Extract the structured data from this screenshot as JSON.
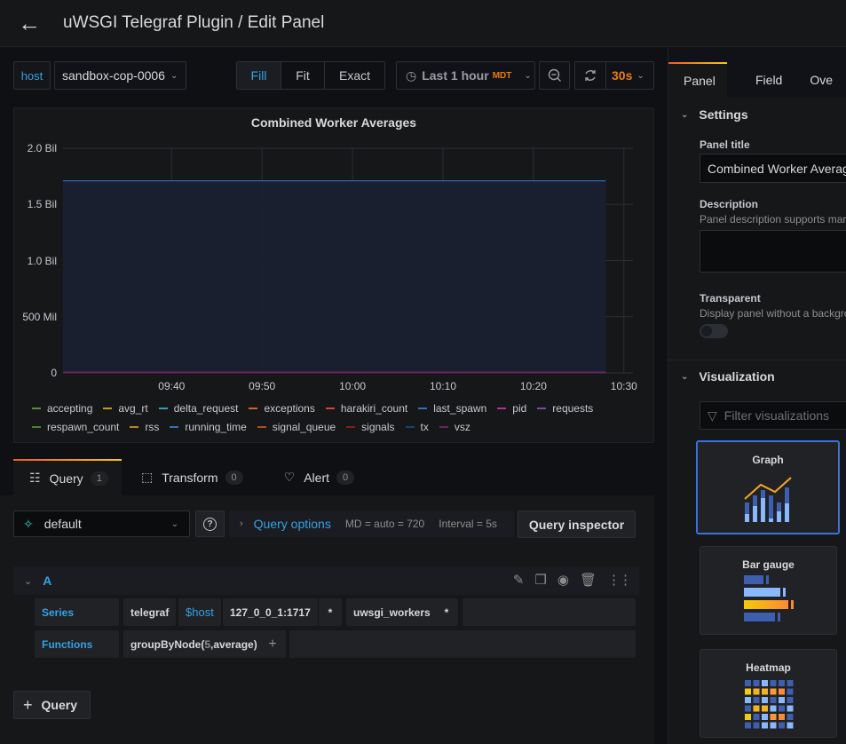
{
  "header": {
    "title": "uWSGI Telegraf Plugin / Edit Panel",
    "back_icon": "arrow-left-icon"
  },
  "toolbar": {
    "variable_label": "host",
    "variable_value": "sandbox-cop-0006",
    "view_modes": [
      {
        "label": "Fill",
        "active": true
      },
      {
        "label": "Fit",
        "active": false
      },
      {
        "label": "Exact",
        "active": false
      }
    ],
    "time_range": "Last 1 hour",
    "timezone": "MDT",
    "refresh_interval": "30s"
  },
  "panel": {
    "title": "Combined Worker Averages"
  },
  "chart_data": {
    "type": "area",
    "title": "Combined Worker Averages",
    "xlabel": "",
    "ylabel": "",
    "x_ticks": [
      "09:40",
      "09:50",
      "10:00",
      "10:10",
      "10:20",
      "10:30"
    ],
    "y_ticks": [
      "0",
      "500 Mil",
      "1.0 Bil",
      "1.5 Bil",
      "2.0 Bil"
    ],
    "ylim": [
      0,
      2000000000
    ],
    "xlim": [
      "09:28",
      "10:31"
    ],
    "grid": true,
    "legend_position": "bottom",
    "series": [
      {
        "name": "accepting",
        "color": "#629e51",
        "values": [
          0,
          0
        ]
      },
      {
        "name": "avg_rt",
        "color": "#e5ac0e",
        "values": [
          0,
          0
        ]
      },
      {
        "name": "delta_request",
        "color": "#64b0c8",
        "values": [
          0,
          0
        ]
      },
      {
        "name": "exceptions",
        "color": "#e5a8e2",
        "values": [
          0,
          0
        ]
      },
      {
        "name": "harakiri_count",
        "color": "#bf1b00",
        "values": [
          0,
          0
        ]
      },
      {
        "name": "last_spawn",
        "color": "#0a437c",
        "values": [
          1710000000,
          1710000000
        ]
      },
      {
        "name": "pid",
        "color": "#6d1f62",
        "values": [
          0,
          0
        ]
      },
      {
        "name": "requests",
        "color": "#584477",
        "values": [
          0,
          0
        ]
      },
      {
        "name": "respawn_count",
        "color": "#508642",
        "values": [
          0,
          0
        ]
      },
      {
        "name": "rss",
        "color": "#cca300",
        "values": [
          0,
          0
        ]
      },
      {
        "name": "running_time",
        "color": "#447ebc",
        "values": [
          0,
          0
        ]
      },
      {
        "name": "signal_queue",
        "color": "#c15c17",
        "values": [
          0,
          0
        ]
      },
      {
        "name": "signals",
        "color": "#890f02",
        "values": [
          0,
          0
        ]
      },
      {
        "name": "tx",
        "color": "#0a437c",
        "values": [
          0,
          0
        ]
      },
      {
        "name": "vsz",
        "color": "#6d1f62",
        "values": [
          0,
          0
        ]
      }
    ],
    "series_x": [
      "09:28",
      "10:28"
    ]
  },
  "legend_colors": [
    "#5a8c3f",
    "#c49a1d",
    "#3d9db5",
    "#d6632c",
    "#d8403a",
    "#2f70c2",
    "#b3328f",
    "#6e4f9e",
    "#4f7f3a",
    "#b38b21",
    "#3f6fb6",
    "#b04e1a",
    "#8c1a14",
    "#1e3f70",
    "#6a2460"
  ],
  "query_tabs": [
    {
      "label": "Query",
      "count": "1",
      "icon": "database-icon",
      "active": true
    },
    {
      "label": "Transform",
      "count": "0",
      "icon": "transform-icon",
      "active": false
    },
    {
      "label": "Alert",
      "count": "0",
      "icon": "bell-icon",
      "active": false
    }
  ],
  "query": {
    "datasource": "default",
    "options_label": "Query options",
    "max_data_points": "MD = auto = 720",
    "interval": "Interval = 5s",
    "inspector_label": "Query inspector",
    "ref_id": "A",
    "series_label": "Series",
    "series_segments": [
      "telegraf",
      "$host",
      "127_0_0_1:1717",
      "*",
      "uwsgi_workers",
      "*"
    ],
    "functions_label": "Functions",
    "function_name": "groupByNode(",
    "function_arg1": "5",
    "function_rest": ",average)",
    "add_function": "+",
    "add_query_label": "Query"
  },
  "options_pane": {
    "tabs": [
      {
        "label": "Panel",
        "active": true
      },
      {
        "label": "Field",
        "active": false
      },
      {
        "label": "Ove",
        "active": false
      }
    ],
    "settings_header": "Settings",
    "panel_title_label": "Panel title",
    "panel_title_value": "Combined Worker Averages",
    "description_label": "Description",
    "description_hint": "Panel description supports markdown",
    "transparent_label": "Transparent",
    "transparent_hint": "Display panel without a background",
    "transparent_on": false,
    "visualization_header": "Visualization",
    "filter_placeholder": "Filter visualizations",
    "visualizations": [
      {
        "label": "Graph",
        "selected": true
      },
      {
        "label": "Bar gauge",
        "selected": false
      },
      {
        "label": "Heatmap",
        "selected": false
      }
    ]
  }
}
